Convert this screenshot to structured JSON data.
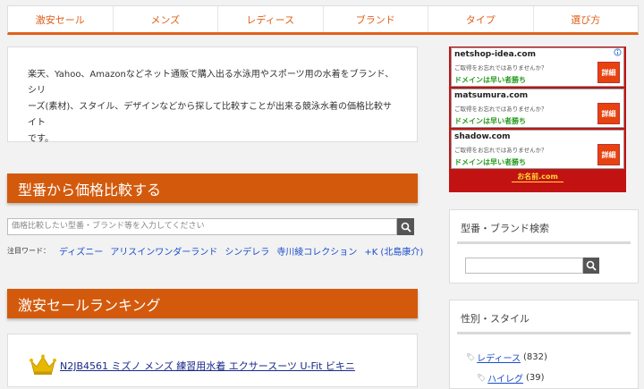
{
  "nav": [
    "激安セール",
    "メンズ",
    "レディース",
    "ブランド",
    "タイプ",
    "選び方"
  ],
  "intro": {
    "line1": "楽天、Yahoo、Amazonなどネット通販で購入出る水泳用やスポーツ用の水着をブランド、シリ",
    "line2": "ーズ(素材)、スタイル、デザインなどから探して比較すことが出来る競泳水着の価格比較サイト",
    "line3": "です。"
  },
  "compare": {
    "title": "型番から価格比較する",
    "placeholder": "価格比較したい型番・ブランド等を入力してください",
    "hot_label": "注目ワード：",
    "hot_words": [
      "ディズニー",
      "アリスインワンダーランド",
      "シンデレラ",
      "寺川綾コレクション",
      "+K (北島康介)"
    ]
  },
  "ranking": {
    "title": "激安セールランキング",
    "first_item": "N2JB4561 ミズノ メンズ 練習用水着 エクサースーツ U-Fit ビキニ"
  },
  "ad": {
    "cards": [
      {
        "domain": "netshop-idea.com",
        "sub": "ご取得をお忘れではありませんか？",
        "green": "ドメインは早い者勝ち",
        "btn": "詳細"
      },
      {
        "domain": "matsumura.com",
        "sub": "ご取得をお忘れではありませんか？",
        "green": "ドメインは早い者勝ち",
        "btn": "詳細"
      },
      {
        "domain": "shadow.com",
        "sub": "ご取得をお忘れではありませんか？",
        "green": "ドメインは早い者勝ち",
        "btn": "詳細"
      }
    ],
    "logo": "お名前.com"
  },
  "sidebar": {
    "search_title": "型番・ブランド検索",
    "style_title": "性別・スタイル",
    "categories": [
      {
        "label": "レディース",
        "count": "(832)"
      },
      {
        "label": "ハイレグ",
        "count": "(39)"
      }
    ]
  },
  "colors": {
    "accent": "#d35a0c",
    "nav_text": "#e0611a",
    "link": "#1a4dcc"
  }
}
